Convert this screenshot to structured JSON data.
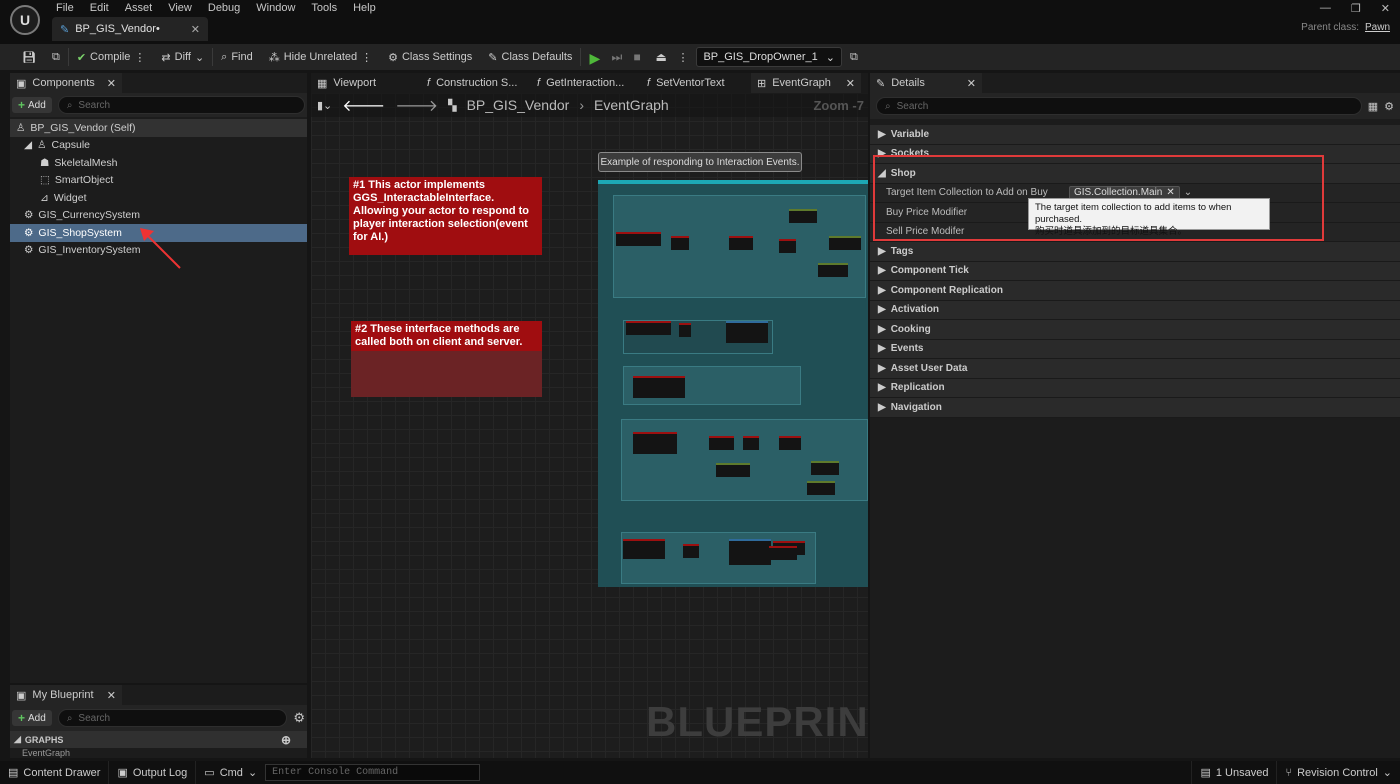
{
  "menu": [
    "File",
    "Edit",
    "Asset",
    "View",
    "Debug",
    "Window",
    "Tools",
    "Help"
  ],
  "doc_tab": {
    "label": "BP_GIS_Vendor•"
  },
  "parent_class": {
    "label": "Parent class:",
    "value": "Pawn"
  },
  "toolbar": {
    "compile": "Compile",
    "diff": "Diff",
    "find": "Find",
    "hide_unrelated": "Hide Unrelated",
    "class_settings": "Class Settings",
    "class_defaults": "Class Defaults",
    "debug_object": "BP_GIS_DropOwner_1"
  },
  "components": {
    "tab": "Components",
    "add": "Add",
    "search_placeholder": "Search",
    "items": [
      {
        "label": "BP_GIS_Vendor (Self)"
      },
      {
        "label": "Capsule"
      },
      {
        "label": "SkeletalMesh"
      },
      {
        "label": "SmartObject"
      },
      {
        "label": "Widget"
      },
      {
        "label": "GIS_CurrencySystem"
      },
      {
        "label": "GIS_ShopSystem"
      },
      {
        "label": "GIS_InventorySystem"
      }
    ]
  },
  "my_blueprint": {
    "tab": "My Blueprint",
    "add": "Add",
    "search_placeholder": "Search",
    "graphs": "GRAPHS",
    "event_graph": "EventGraph"
  },
  "graph_tabs": [
    "Viewport",
    "Construction S...",
    "GetInteraction...",
    "SetVentorText",
    "EventGraph"
  ],
  "graph": {
    "breadcrumb_bp": "BP_GIS_Vendor",
    "breadcrumb_graph": "EventGraph",
    "zoom": "Zoom -7",
    "bubble": "Example of responding to Interaction Events.",
    "comment1": "#1 This actor implements GGS_InteractableInterface. Allowing your actor to respond to player interaction selection(event for AI.)",
    "comment2": "#2 These interface methods are called both on client and server.",
    "watermark": "BLUEPRINT"
  },
  "details": {
    "tab": "Details",
    "search_placeholder": "Search",
    "categories": [
      "Variable",
      "Sockets",
      "Shop",
      "Tags",
      "Component Tick",
      "Component Replication",
      "Activation",
      "Cooking",
      "Events",
      "Asset User Data",
      "Replication",
      "Navigation"
    ],
    "shop_props": [
      {
        "label": "Target Item Collection to Add on Buy",
        "value": "GIS.Collection.Main"
      },
      {
        "label": "Buy Price Modifier"
      },
      {
        "label": "Sell Price Modifer"
      }
    ],
    "tooltip_en": "The target item collection to add items to when purchased.",
    "tooltip_zh": "购买时道具添加到的目标道具集合。"
  },
  "bottom": {
    "content_drawer": "Content Drawer",
    "output_log": "Output Log",
    "cmd": "Cmd",
    "console_placeholder": "Enter Console Command",
    "unsaved": "1 Unsaved",
    "revision": "Revision Control"
  }
}
